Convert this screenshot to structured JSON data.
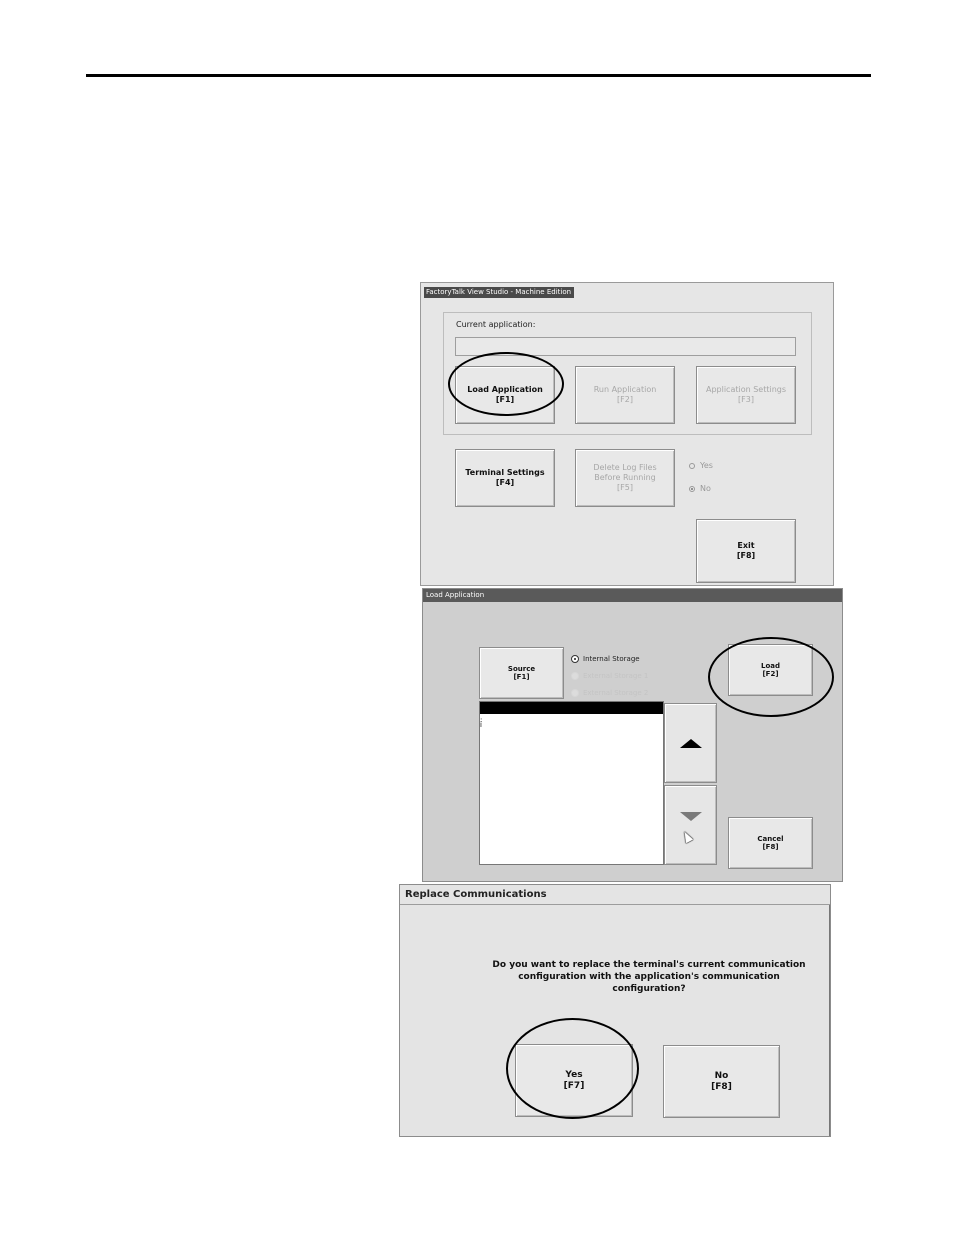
{
  "panel1": {
    "window_title": "FactoryTalk View Studio - Machine Edition",
    "current_application_label": "Current application:",
    "current_application_value": "",
    "buttons": {
      "load_application": {
        "label": "Load Application",
        "key": "[F1]"
      },
      "run_application": {
        "label": "Run Application",
        "key": "[F2]"
      },
      "application_settings": {
        "label": "Application Settings",
        "key": "[F3]"
      },
      "terminal_settings": {
        "label": "Terminal Settings",
        "key": "[F4]"
      },
      "delete_log_files": {
        "label_line1": "Delete Log Files",
        "label_line2": "Before Running",
        "key": "[F5]"
      },
      "exit": {
        "label": "Exit",
        "key": "[F8]"
      }
    },
    "options": {
      "yes": "Yes",
      "no": "No",
      "selected": "No"
    }
  },
  "panel2": {
    "window_title": "Load Application",
    "source_button": {
      "label": "Source",
      "key": "[F1]"
    },
    "storage_options": [
      "Internal Storage",
      "External Storage 1",
      "External Storage 2"
    ],
    "selected_storage": "Internal Storage",
    "load_button": {
      "label": "Load",
      "key": "[F2]"
    },
    "cancel_button": {
      "label": "Cancel",
      "key": "[F8]"
    },
    "list_items": [
      ":",
      "i"
    ]
  },
  "panel3": {
    "window_title": "Replace Communications",
    "question_line1": "Do you want to replace the terminal's current communication",
    "question_line2": "configuration with the application's communication configuration?",
    "yes_button": {
      "label": "Yes",
      "key": "[F7]"
    },
    "no_button": {
      "label": "No",
      "key": "[F8]"
    }
  }
}
